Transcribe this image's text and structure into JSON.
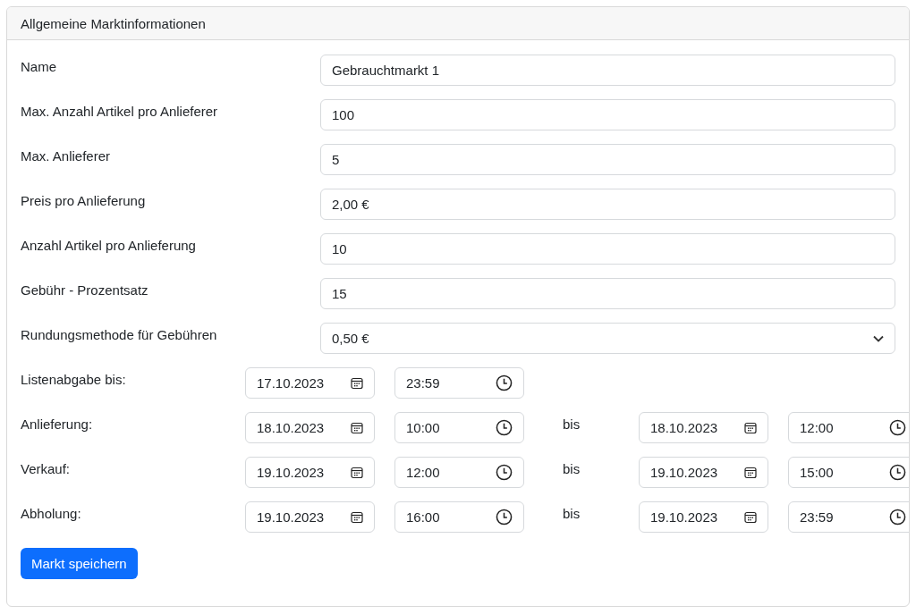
{
  "card": {
    "title": "Allgemeine Marktinformationen"
  },
  "fields": [
    {
      "label": "Name",
      "kind": "text",
      "value": "Gebrauchtmarkt 1"
    },
    {
      "label": "Max. Anzahl Artikel pro Anlieferer",
      "kind": "text",
      "value": "100"
    },
    {
      "label": "Max. Anlieferer",
      "kind": "text",
      "value": "5"
    },
    {
      "label": "Preis pro Anlieferung",
      "kind": "text",
      "value": "2,00 €"
    },
    {
      "label": "Anzahl Artikel pro Anlieferung",
      "kind": "text",
      "value": "10"
    },
    {
      "label": "Gebühr - Prozentsatz",
      "kind": "text",
      "value": "15"
    },
    {
      "label": "Rundungsmethode für Gebühren",
      "kind": "select",
      "value": "0,50 €"
    }
  ],
  "schedule": [
    {
      "label": "Listenabgabe bis:",
      "start_date": "17.10.2023",
      "start_time": "23:59"
    },
    {
      "label": "Anlieferung:",
      "start_date": "18.10.2023",
      "start_time": "10:00",
      "separator": "bis",
      "end_date": "18.10.2023",
      "end_time": "12:00"
    },
    {
      "label": "Verkauf:",
      "start_date": "19.10.2023",
      "start_time": "12:00",
      "separator": "bis",
      "end_date": "19.10.2023",
      "end_time": "15:00"
    },
    {
      "label": "Abholung:",
      "start_date": "19.10.2023",
      "start_time": "16:00",
      "separator": "bis",
      "end_date": "19.10.2023",
      "end_time": "23:59"
    }
  ],
  "submit_button": "Markt speichern"
}
